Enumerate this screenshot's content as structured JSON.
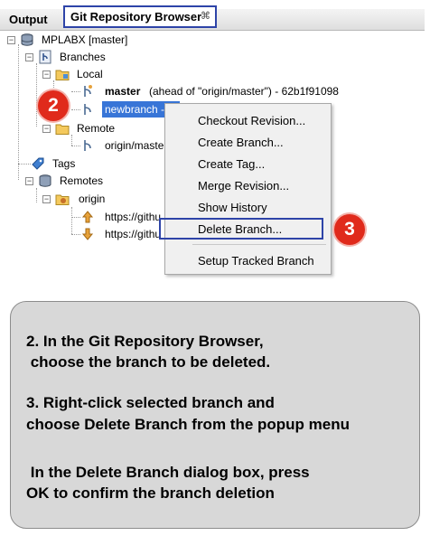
{
  "tabs": {
    "output": "Output",
    "git_browser": "Git Repository Browser",
    "close_glyph": "⌘"
  },
  "tree": {
    "repo": "MPLABX [master]",
    "branches": "Branches",
    "local": "Local",
    "master_name": "master",
    "master_detail": "(ahead of \"origin/master\") - 62b1f91098",
    "newbranch": "newbranch - ",
    "remote": "Remote",
    "origin_master": "origin/master",
    "tags": "Tags",
    "remotes": "Remotes",
    "origin": "origin",
    "fetch_url": "https://githu",
    "push_url": "https://githu"
  },
  "badges": {
    "step2": "2",
    "step3": "3"
  },
  "menu": {
    "items": [
      "Checkout Revision...",
      "Create Branch...",
      "Create Tag...",
      "Merge Revision...",
      "Show History",
      "Delete Branch...",
      "Setup Tracked Branch"
    ]
  },
  "instructions": {
    "line1": "2. In the Git Repository Browser,",
    "line2": " choose the branch to be deleted.",
    "line3": "3. Right-click selected branch and",
    "line4": "choose Delete Branch from the popup menu",
    "line5": " In the Delete Branch dialog box, press",
    "line6": "OK to confirm the branch deletion"
  },
  "colors": {
    "highlight_border": "#2e44a8",
    "badge": "#e02a1b",
    "selection": "#3875d7"
  }
}
